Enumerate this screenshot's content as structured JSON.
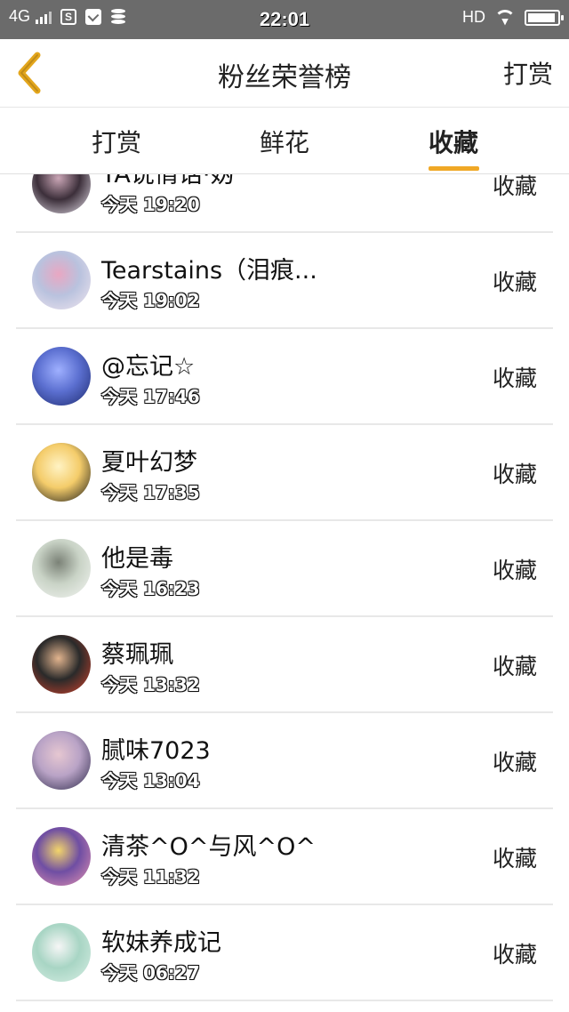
{
  "status_bar": {
    "network": "4G",
    "time": "22:01",
    "hd": "HD",
    "battery_level": 0.95,
    "icons": [
      "signal-icon",
      "s-app-icon",
      "message-icon",
      "database-icon",
      "wifi-icon",
      "battery-icon"
    ]
  },
  "nav": {
    "title": "粉丝荣誉榜",
    "right_label": "打赏",
    "back_icon": "chevron-left-icon",
    "accent_color": "#f0a826"
  },
  "tabs": [
    {
      "label": "打赏",
      "active": false
    },
    {
      "label": "鲜花",
      "active": false
    },
    {
      "label": "收藏",
      "active": true
    }
  ],
  "rows": [
    {
      "name": "TA说情话·妫",
      "time": "今天 19:20",
      "action": "收藏",
      "avatar_colors": [
        "#e9e3ee",
        "#3c2f3a",
        "#caa6b6"
      ]
    },
    {
      "name": "Tearstains（泪痕...",
      "time": "今天 19:02",
      "action": "收藏",
      "avatar_colors": [
        "#f1e6ef",
        "#b9c2de",
        "#e9a7c2"
      ]
    },
    {
      "name": "@忘记☆",
      "time": "今天 17:46",
      "action": "收藏",
      "avatar_colors": [
        "#1d2a6e",
        "#5b6fd0",
        "#9fb0ff"
      ]
    },
    {
      "name": "夏叶幻梦",
      "time": "今天 17:35",
      "action": "收藏",
      "avatar_colors": [
        "#161616",
        "#f4cc6a",
        "#fff3c4"
      ]
    },
    {
      "name": "他是毒",
      "time": "今天 16:23",
      "action": "收藏",
      "avatar_colors": [
        "#f4f6f3",
        "#c9d3c6",
        "#7b8277"
      ]
    },
    {
      "name": "蔡珮珮",
      "time": "今天 13:32",
      "action": "收藏",
      "avatar_colors": [
        "#d8432c",
        "#2a2a2a",
        "#e2b48e"
      ]
    },
    {
      "name": "腻味7023",
      "time": "今天 13:04",
      "action": "收藏",
      "avatar_colors": [
        "#2a2748",
        "#b9a3c6",
        "#e6c7d1"
      ]
    },
    {
      "name": "清茶^O^与风^O^",
      "time": "今天 11:32",
      "action": "收藏",
      "avatar_colors": [
        "#e794b2",
        "#6f4ea3",
        "#f3d56a"
      ]
    },
    {
      "name": "软妹养成记",
      "time": "今天 06:27",
      "action": "收藏",
      "avatar_colors": [
        "#d9efe5",
        "#a8d5c4",
        "#f6f6f6"
      ]
    }
  ]
}
